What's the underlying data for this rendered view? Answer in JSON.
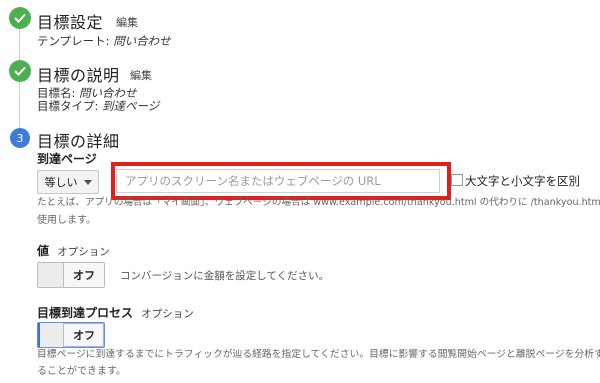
{
  "step1": {
    "title": "目標設定",
    "edit": "編集",
    "template_label": "テンプレート: ",
    "template_value": "問い合わせ"
  },
  "step2": {
    "title": "目標の説明",
    "edit": "編集",
    "name_label": "目標名: ",
    "name_value": "問い合わせ",
    "type_label": "目標タイプ: ",
    "type_value": "到達ページ"
  },
  "step3": {
    "number": "3",
    "title": "目標の詳細",
    "destination": {
      "label": "到達ページ",
      "match_select": "等しい",
      "url_placeholder": "アプリのスクリーン名またはウェブページの URL",
      "url_value": "",
      "case_sensitive_label": "大文字と小文字を区別",
      "help_line1": "たとえば、アプリの場合は「マイ画面」、ウェブページの場合は www.example.com/thankyou.html の代わりに /thankyou.html を",
      "help_line2": "使用します。"
    },
    "value": {
      "label": "値",
      "optional": "オプション",
      "toggle": "オフ",
      "help": "コンバージョンに金額を設定してください。"
    },
    "funnel": {
      "label": "目標到達プロセス",
      "optional": "オプション",
      "toggle": "オフ",
      "help_line1": "目標ページに到達するまでにトラフィックが辿る経路を指定してください。目標に影響する閲覧開始ページと離脱ページを分析す",
      "help_line2": "ることができます。"
    }
  },
  "colors": {
    "done": "#4caf50",
    "active": "#3f7cd9",
    "highlight": "#e0201b"
  }
}
